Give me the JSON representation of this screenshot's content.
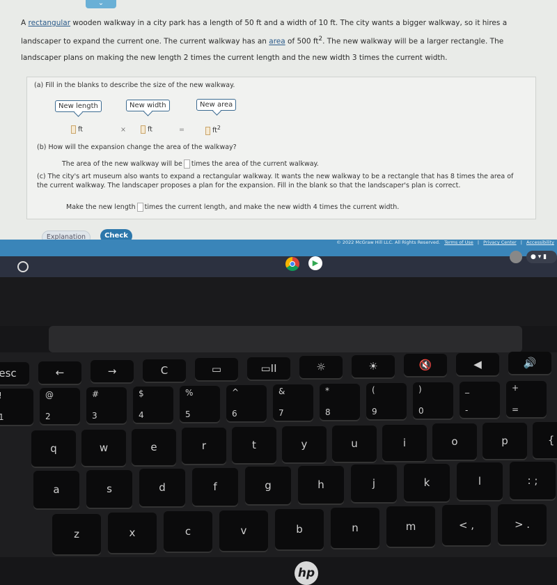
{
  "problem": {
    "intro_parts": [
      "A ",
      "rectangular",
      " wooden walkway in a city park has a length of 50 ft and a width of 10 ft. The city wants a bigger walkway, so it hires a landscaper to expand the current one. The current walkway has an ",
      "area",
      " of 500 ft",
      "2",
      ". The new walkway will be a larger rectangle. The landscaper plans on making the new length 2 times the current length and the new width 3 times the current width."
    ],
    "part_a": {
      "prompt": "(a)  Fill in the blanks to describe the size of the new walkway.",
      "tag_length": "New length",
      "tag_width": "New width",
      "tag_area": "New area",
      "unit_ft": "ft",
      "times": "×",
      "equals": "=",
      "unit_ft2": "ft",
      "sup": "2"
    },
    "part_b": {
      "prompt": "(b)  How will the expansion change the area of the walkway?",
      "before": "The area of the new walkway will be",
      "after": "times the area of the current walkway."
    },
    "part_c": {
      "prompt": "(c)  The city's art museum also wants to expand a rectangular walkway. It wants the new walkway to be a rectangle that has 8 times the area of the current walkway. The landscaper proposes a plan for the expansion. Fill in the blank so that the landscaper's plan is correct.",
      "before": "Make the new length",
      "after": "times the current length, and make the new width 4 times the current width."
    }
  },
  "buttons": {
    "explanation": "Explanation",
    "check": "Check"
  },
  "footer": {
    "copyright": "© 2022 McGraw Hill LLC. All Rights Reserved.",
    "terms": "Terms of Use",
    "sep": "|",
    "privacy": "Privacy Center",
    "accessibility": "Accessibility"
  },
  "laptop": {
    "logo": "hp"
  },
  "keyboard": {
    "fn_row": [
      "esc",
      "←",
      "→",
      "C",
      "▭",
      "▭II",
      "☼",
      "☀",
      "🔇",
      "◀",
      "🔊"
    ],
    "num_row": [
      [
        "!",
        "1"
      ],
      [
        "@",
        "2"
      ],
      [
        "#",
        "3"
      ],
      [
        "$",
        "4"
      ],
      [
        "%",
        "5"
      ],
      [
        "^",
        "6"
      ],
      [
        "&",
        "7"
      ],
      [
        "*",
        "8"
      ],
      [
        "(",
        "9"
      ],
      [
        ")",
        "0"
      ],
      [
        "_",
        "-"
      ],
      [
        "+",
        "="
      ]
    ],
    "row_q": [
      "q",
      "w",
      "e",
      "r",
      "t",
      "y",
      "u",
      "i",
      "o",
      "p",
      "{ ["
    ],
    "row_a": [
      "a",
      "s",
      "d",
      "f",
      "g",
      "h",
      "j",
      "k",
      "l",
      ": ;"
    ],
    "row_z": [
      "z",
      "x",
      "c",
      "v",
      "b",
      "n",
      "m",
      "< ,",
      "> ."
    ]
  }
}
